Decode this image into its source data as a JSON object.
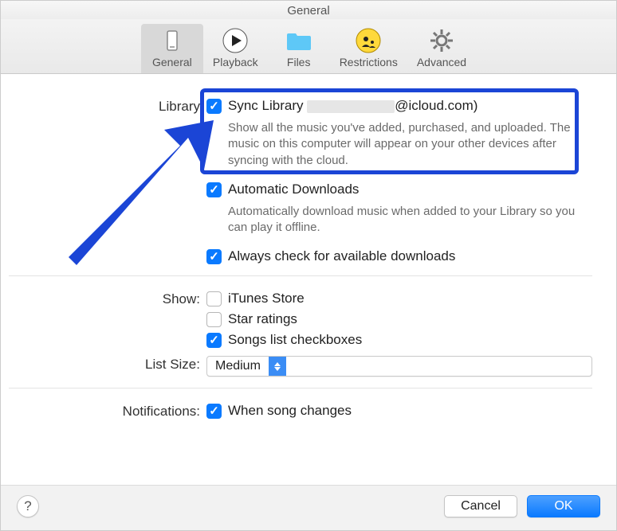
{
  "title": "General",
  "tabs": [
    {
      "label": "General",
      "active": true
    },
    {
      "label": "Playback",
      "active": false
    },
    {
      "label": "Files",
      "active": false
    },
    {
      "label": "Restrictions",
      "active": false
    },
    {
      "label": "Advanced",
      "active": false
    }
  ],
  "library": {
    "label": "Library",
    "sync": {
      "checked": true,
      "label_prefix": "Sync Library",
      "label_suffix": "@icloud.com)",
      "desc": "Show all the music you've added, purchased, and uploaded. The music on this computer will appear on your other devices after syncing with the cloud."
    },
    "auto_downloads": {
      "checked": true,
      "label": "Automatic Downloads",
      "desc": "Automatically download music when added to your Library so you can play it offline."
    },
    "check_downloads": {
      "checked": true,
      "label": "Always check for available downloads"
    }
  },
  "show": {
    "label": "Show:",
    "itunes_store": {
      "checked": false,
      "label": "iTunes Store"
    },
    "star_ratings": {
      "checked": false,
      "label": "Star ratings"
    },
    "songs_list_checkboxes": {
      "checked": true,
      "label": "Songs list checkboxes"
    }
  },
  "list_size": {
    "label": "List Size:",
    "value": "Medium"
  },
  "notifications": {
    "label": "Notifications:",
    "song_changes": {
      "checked": true,
      "label": "When song changes"
    }
  },
  "footer": {
    "help": "?",
    "cancel": "Cancel",
    "ok": "OK"
  }
}
